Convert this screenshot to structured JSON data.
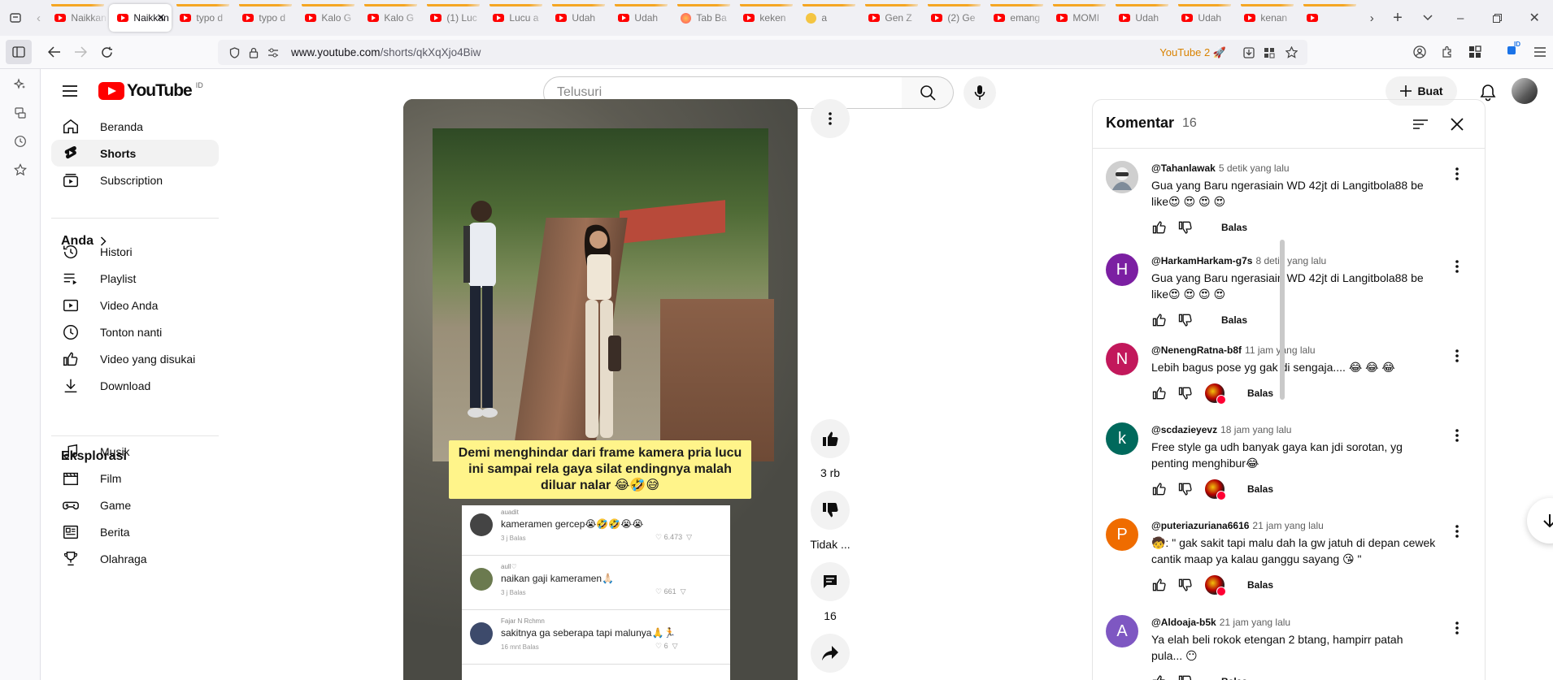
{
  "browser": {
    "tabs": [
      {
        "label": "Naikkan",
        "fav": "youtube"
      },
      {
        "label": "Naikkan",
        "fav": "youtube",
        "active": true
      },
      {
        "label": "typo d",
        "fav": "youtube"
      },
      {
        "label": "typo d",
        "fav": "youtube"
      },
      {
        "label": "Kalo G",
        "fav": "youtube"
      },
      {
        "label": "Kalo G",
        "fav": "youtube"
      },
      {
        "label": "(1) Luc",
        "fav": "youtube"
      },
      {
        "label": "Lucu a",
        "fav": "youtube"
      },
      {
        "label": "Udah",
        "fav": "youtube"
      },
      {
        "label": "Udah",
        "fav": "youtube"
      },
      {
        "label": "Tab Ba",
        "fav": "firefox"
      },
      {
        "label": "keken",
        "fav": "youtube"
      },
      {
        "label": "a",
        "fav": "emoji"
      },
      {
        "label": "Gen Z",
        "fav": "youtube"
      },
      {
        "label": "(2) Ge",
        "fav": "youtube"
      },
      {
        "label": "emang",
        "fav": "youtube"
      },
      {
        "label": "MOMI",
        "fav": "youtube"
      },
      {
        "label": "Udah",
        "fav": "youtube"
      },
      {
        "label": "Udah",
        "fav": "youtube"
      },
      {
        "label": "kenan",
        "fav": "youtube"
      },
      {
        "label": "",
        "fav": "youtube"
      }
    ],
    "url_host": "www.youtube.com",
    "url_path": "/shorts/qkXqXjo4Biw",
    "site_badge": "YouTube 2"
  },
  "youtube": {
    "logo_text": "YouTube",
    "country_code": "ID",
    "search_placeholder": "Telusuri",
    "create_label": "Buat"
  },
  "nav": {
    "main": [
      {
        "label": "Beranda",
        "icon": "home-icon"
      },
      {
        "label": "Shorts",
        "icon": "shorts-icon",
        "selected": true
      },
      {
        "label": "Subscription",
        "icon": "subscriptions-icon"
      }
    ],
    "you_header": "Anda",
    "you": [
      {
        "label": "Histori",
        "icon": "history-icon"
      },
      {
        "label": "Playlist",
        "icon": "playlist-icon"
      },
      {
        "label": "Video Anda",
        "icon": "your-videos-icon"
      },
      {
        "label": "Tonton nanti",
        "icon": "watch-later-icon"
      },
      {
        "label": "Video yang disukai",
        "icon": "liked-icon"
      },
      {
        "label": "Download",
        "icon": "download-icon"
      }
    ],
    "explore_header": "Eksplorasi",
    "explore": [
      {
        "label": "Musik",
        "icon": "music-icon"
      },
      {
        "label": "Film",
        "icon": "film-icon"
      },
      {
        "label": "Game",
        "icon": "gaming-icon"
      },
      {
        "label": "Berita",
        "icon": "news-icon"
      },
      {
        "label": "Olahraga",
        "icon": "sports-icon"
      }
    ]
  },
  "short": {
    "caption": "Demi menghindar dari frame kamera pria lucu ini sampai rela gaya silat endingnya malah diluar nalar 😂🤣😅",
    "overlay_comments": [
      {
        "name": "auadit",
        "text": "kameramen gercep😭🤣🤣😭😭",
        "meta": "3 j    Balas",
        "likes": "6.473"
      },
      {
        "name": "aull♡",
        "text": "naikan gaji kameramen🙏🏻",
        "meta": "3 j    Balas",
        "likes": "661"
      },
      {
        "name": "Fajar N Rchmn",
        "text": "sakitnya ga seberapa tapi malunya🙏🏃",
        "meta": "16 mnt    Balas",
        "likes": "6"
      }
    ],
    "like_count": "3 rb",
    "dislike_label": "Tidak ...",
    "comment_count": "16"
  },
  "comments": {
    "title": "Komentar",
    "count": "16",
    "reply_label": "Balas",
    "items": [
      {
        "user": "@Tahanlawak",
        "time": "5 detik yang lalu",
        "text": "Gua yang Baru ngerasiain WD 42jt di Langitbola88 be like😍 😍 😍 😍",
        "avatar_letter": "",
        "avatar_color": "#d9d9d9",
        "creator_heart": false
      },
      {
        "user": "@HarkamHarkam-g7s",
        "time": "8 detik yang lalu",
        "text": "Gua yang Baru ngerasiain WD 42jt di Langitbola88 be like😍 😍 😍 😍",
        "avatar_letter": "H",
        "avatar_color": "#7b1fa2",
        "creator_heart": false
      },
      {
        "user": "@NenengRatna-b8f",
        "time": "11 jam yang lalu",
        "text": "Lebih bagus pose yg gak di sengaja.... 😂 😂 😂",
        "avatar_letter": "N",
        "avatar_color": "#c2185b",
        "creator_heart": true
      },
      {
        "user": "@scdazieyevz",
        "time": "18 jam yang lalu",
        "text": "Free style ga udh banyak gaya kan jdi sorotan, yg penting menghibur😂",
        "avatar_letter": "k",
        "avatar_color": "#00695c",
        "creator_heart": true
      },
      {
        "user": "@puteriazuriana6616",
        "time": "21 jam yang lalu",
        "text": "🧒: \" gak sakit tapi malu dah la gw jatuh di depan cewek cantik maap ya kalau ganggu sayang 😘 \"",
        "avatar_letter": "P",
        "avatar_color": "#ef6c00",
        "creator_heart": true
      },
      {
        "user": "@Aldoaja-b5k",
        "time": "21 jam yang lalu",
        "text": "Ya elah beli rokok etengan 2 btang, hampirr patah pula... 😶",
        "avatar_letter": "A",
        "avatar_color": "#7e57c2",
        "creator_heart": false
      }
    ]
  }
}
